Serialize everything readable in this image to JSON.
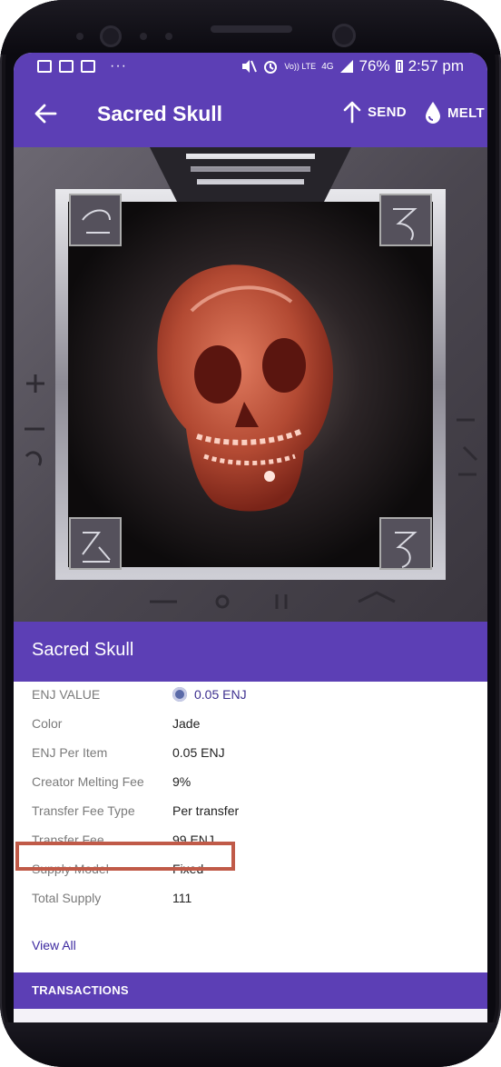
{
  "status_bar": {
    "network": "4G",
    "lte": "Vo)) LTE",
    "battery": "76%",
    "time": "2:57 pm",
    "more": "···"
  },
  "app_bar": {
    "title": "Sacred Skull",
    "send_label": "SEND",
    "melt_label": "MELT"
  },
  "hero": {
    "image_subject": "red skull inside carved stone frame"
  },
  "item": {
    "name": "Sacred Skull"
  },
  "details": [
    {
      "label": "ENJ VALUE",
      "value": "0.05 ENJ"
    },
    {
      "label": "Color",
      "value": "Jade"
    },
    {
      "label": "ENJ Per Item",
      "value": "0.05 ENJ"
    },
    {
      "label": "Creator Melting Fee",
      "value": "9%"
    },
    {
      "label": "Transfer Fee Type",
      "value": "Per transfer"
    },
    {
      "label": "Transfer Fee",
      "value": "99 ENJ"
    },
    {
      "label": "Supply Model",
      "value": "Fixed"
    },
    {
      "label": "Total Supply",
      "value": "111"
    }
  ],
  "view_all_label": "View All",
  "transactions_label": "TRANSACTIONS",
  "colors": {
    "primary": "#5c3fb5",
    "highlight": "#c05a48",
    "link": "#3d2aa0"
  }
}
